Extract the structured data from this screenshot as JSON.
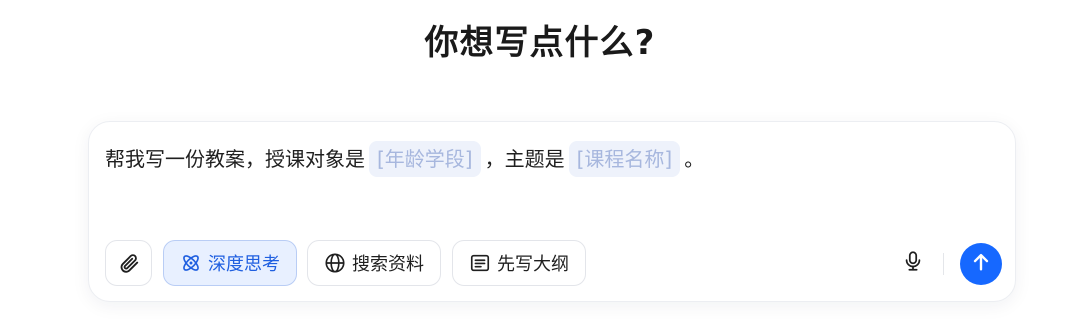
{
  "page": {
    "title": "你想写点什么?"
  },
  "composer": {
    "prompt_before": "帮我写一份教案，授课对象是",
    "slot_1": "[年龄学段]",
    "prompt_middle": "，主题是",
    "slot_2": "[课程名称]",
    "prompt_after": "。"
  },
  "toolbar": {
    "attach_icon": "paperclip-icon",
    "deep_think_label": "深度思考",
    "deep_think_icon": "atom-icon",
    "deep_think_active": true,
    "search_label": "搜索资料",
    "search_icon": "globe-icon",
    "outline_label": "先写大纲",
    "outline_icon": "outline-doc-icon",
    "mic_icon": "microphone-icon",
    "send_icon": "arrow-up-icon"
  },
  "colors": {
    "accent": "#1668ff",
    "active_bg": "#e8f0ff",
    "active_text": "#1f5fe0",
    "slot_bg": "#eef2fb",
    "slot_text": "#a7b7de"
  }
}
